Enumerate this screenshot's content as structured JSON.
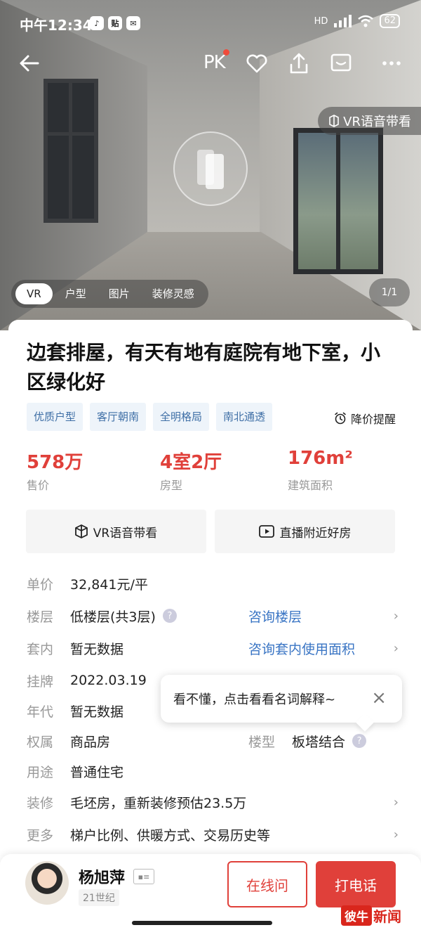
{
  "status_bar": {
    "time": "中午12:34",
    "network": "HD",
    "battery": "62"
  },
  "topnav": {
    "pk_label": "PK"
  },
  "hero": {
    "vr_guide_label": "VR语音带看",
    "media_tabs": [
      {
        "label": "VR",
        "active": true
      },
      {
        "label": "户型",
        "active": false
      },
      {
        "label": "图片",
        "active": false
      },
      {
        "label": "装修灵感",
        "active": false
      }
    ],
    "counter": "1/1"
  },
  "listing": {
    "title": "边套排屋，有天有地有庭院有地下室，小区绿化好",
    "tags": [
      "优质户型",
      "客厅朝南",
      "全明格局",
      "南北通透"
    ],
    "price_alert": "降价提醒",
    "stats": [
      {
        "value": "578万",
        "label": "售价"
      },
      {
        "value": "4室2厅",
        "label": "房型"
      },
      {
        "value": "176m²",
        "label": "建筑面积"
      }
    ],
    "actions": [
      {
        "label": "VR语音带看",
        "icon": "vr-cube-icon"
      },
      {
        "label": "直播附近好房",
        "icon": "live-play-icon"
      }
    ],
    "details": {
      "unit_price": {
        "key": "单价",
        "value": "32,841元/平"
      },
      "floor": {
        "key": "楼层",
        "value": "低楼层(共3层)",
        "link": "咨询楼层"
      },
      "inner": {
        "key": "套内",
        "value": "暂无数据",
        "link": "咨询套内使用面积"
      },
      "listed": {
        "key": "挂牌",
        "value": "2022.03.19"
      },
      "year": {
        "key": "年代",
        "value": "暂无数据"
      },
      "ownership": {
        "key": "权属",
        "value": "商品房",
        "key2": "楼型",
        "value2": "板塔结合"
      },
      "usage": {
        "key": "用途",
        "value": "普通住宅"
      },
      "decor": {
        "key": "装修",
        "value": "毛坯房，重新装修预估23.5万"
      },
      "more": {
        "key": "更多",
        "value": "梯户比例、供暖方式、交易历史等"
      }
    },
    "tooltip": "看不懂，点击看看名词解释~"
  },
  "agent": {
    "name": "杨旭萍",
    "company": "21世纪",
    "online_label": "在线问",
    "call_label": "打电话"
  },
  "watermark": {
    "box": "彼牛",
    "text": "新闻"
  },
  "colors": {
    "accent": "#e0403a",
    "link": "#3a75c4",
    "tag_text": "#3f6fa6"
  }
}
